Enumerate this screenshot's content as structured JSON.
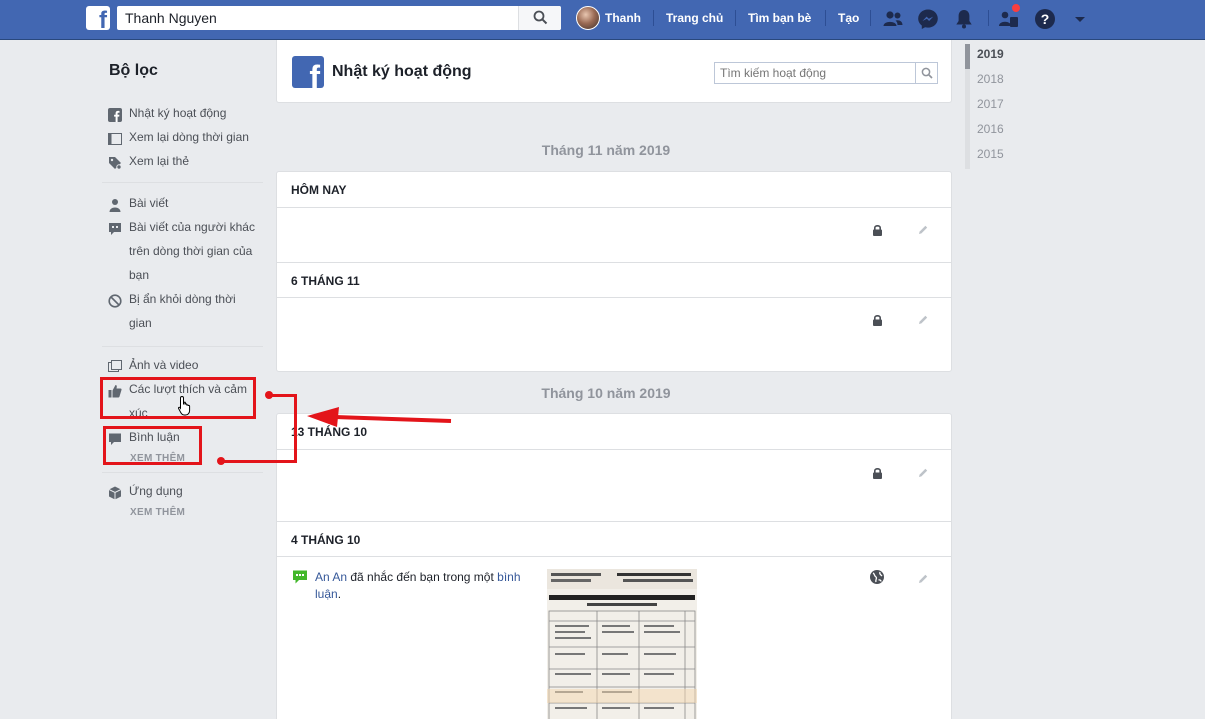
{
  "topbar": {
    "search_value": "Thanh Nguyen",
    "user_name": "Thanh",
    "nav": [
      "Trang chủ",
      "Tìm bạn bè",
      "Tạo"
    ],
    "brand_color": "#4267b2",
    "notification_dot_color": "#fa3e3e"
  },
  "sidebar": {
    "title": "Bộ lọc",
    "group1": [
      {
        "label": "Nhật ký hoạt động",
        "icon": "facebook-icon"
      },
      {
        "label": "Xem lại dòng thời gian",
        "icon": "timeline-icon"
      },
      {
        "label": "Xem lại thẻ",
        "icon": "tag-icon"
      }
    ],
    "group2": [
      {
        "label": "Bài viết",
        "icon": "person-icon"
      },
      {
        "label": "Bài viết của người khác trên dòng thời gian của bạn",
        "icon": "comment-people-icon"
      },
      {
        "label": "Bị ẩn khỏi dòng thời gian",
        "icon": "hidden-icon"
      }
    ],
    "group3": [
      {
        "label": "Ảnh và video",
        "icon": "photos-icon"
      },
      {
        "label": "Các lượt thích và cảm xúc",
        "icon": "thumbs-up-icon"
      },
      {
        "label": "Bình luận",
        "icon": "comment-icon"
      }
    ],
    "more_label": "XEM THÊM",
    "apps_label": "Ứng dụng",
    "apps_more_label": "XEM THÊM"
  },
  "header": {
    "title": "Nhật ký hoạt động",
    "search_placeholder": "Tìm kiếm hoạt động"
  },
  "months": [
    "Tháng 11 năm 2019",
    "Tháng 10 năm 2019"
  ],
  "days": [
    "HÔM NAY",
    "6 THÁNG 11",
    "13 THÁNG 10",
    "4 THÁNG 10"
  ],
  "activity": {
    "actor": "An An",
    "text": " đã nhắc đến bạn trong một ",
    "link": "bình luận",
    "end": "."
  },
  "years": [
    "2019",
    "2018",
    "2017",
    "2016",
    "2015"
  ],
  "annotation_color": "#e3141a"
}
